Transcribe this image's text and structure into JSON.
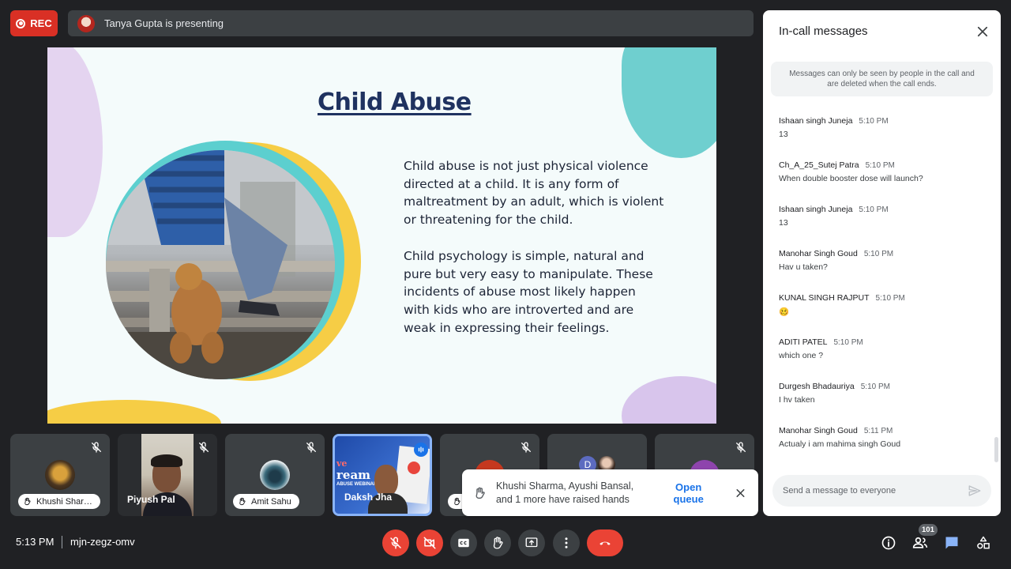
{
  "top_bar": {
    "rec_label": "REC",
    "presenting_text": "Tanya Gupta is presenting"
  },
  "slide": {
    "title": "Child Abuse",
    "paragraph1": "Child abuse is not just physical violence directed at a child. It is any form of maltreatment by an adult, which is violent or threatening for the child.",
    "paragraph2": "Child psychology is simple, natural and pure but very easy to manipulate. These incidents of abuse most likely happen with kids who are introverted and are weak in expressing their feelings."
  },
  "tiles": [
    {
      "name": "Khushi Shar…",
      "hand_raised": true,
      "muted": true
    },
    {
      "name": "Piyush Pal",
      "hand_raised": false,
      "muted": true
    },
    {
      "name": "Amit Sahu",
      "hand_raised": true,
      "muted": true
    },
    {
      "name": "Daksh Jha",
      "hand_raised": false,
      "muted": false,
      "active": true,
      "poster_text": [
        "ve",
        "ream",
        "ABUSE WEBINAR"
      ]
    },
    {
      "name": "",
      "hand_raised": true,
      "muted": true
    },
    {
      "name": "",
      "hand_raised": false,
      "muted": false,
      "avatar_letter": "D"
    },
    {
      "name": "",
      "hand_raised": false,
      "muted": true
    }
  ],
  "toast": {
    "text": "Khushi Sharma, Ayushi Bansal, and 1 more have raised hands",
    "action_label": "Open queue"
  },
  "chat": {
    "title": "In-call messages",
    "notice": "Messages can only be seen by people in the call and are deleted when the call ends.",
    "messages": [
      {
        "sender": "Ishaan singh Juneja",
        "time": "5:10 PM",
        "text": "13"
      },
      {
        "sender": "Ch_A_25_Sutej Patra",
        "time": "5:10 PM",
        "text": "When double booster dose will launch?"
      },
      {
        "sender": "Ishaan singh Juneja",
        "time": "5:10 PM",
        "text": "13"
      },
      {
        "sender": "Manohar Singh Goud",
        "time": "5:10 PM",
        "text": "Hav u taken?"
      },
      {
        "sender": "KUNAL SINGH RAJPUT",
        "time": "5:10 PM",
        "text": "🥴"
      },
      {
        "sender": "ADITI PATEL",
        "time": "5:10 PM",
        "text": "which one ?"
      },
      {
        "sender": "Durgesh Bhadauriya",
        "time": "5:10 PM",
        "text": "I hv taken"
      },
      {
        "sender": "Manohar Singh Goud",
        "time": "5:11 PM",
        "text": "Actualy i am mahima singh Goud"
      }
    ],
    "input_placeholder": "Send a message to everyone"
  },
  "bottom_bar": {
    "time": "5:13 PM",
    "meeting_code": "mjn-zegz-omv",
    "participants_count": "101"
  },
  "colors": {
    "background": "#202124",
    "danger": "#ea4335",
    "accent": "#1a73e8",
    "slide_title": "#1f3260"
  }
}
